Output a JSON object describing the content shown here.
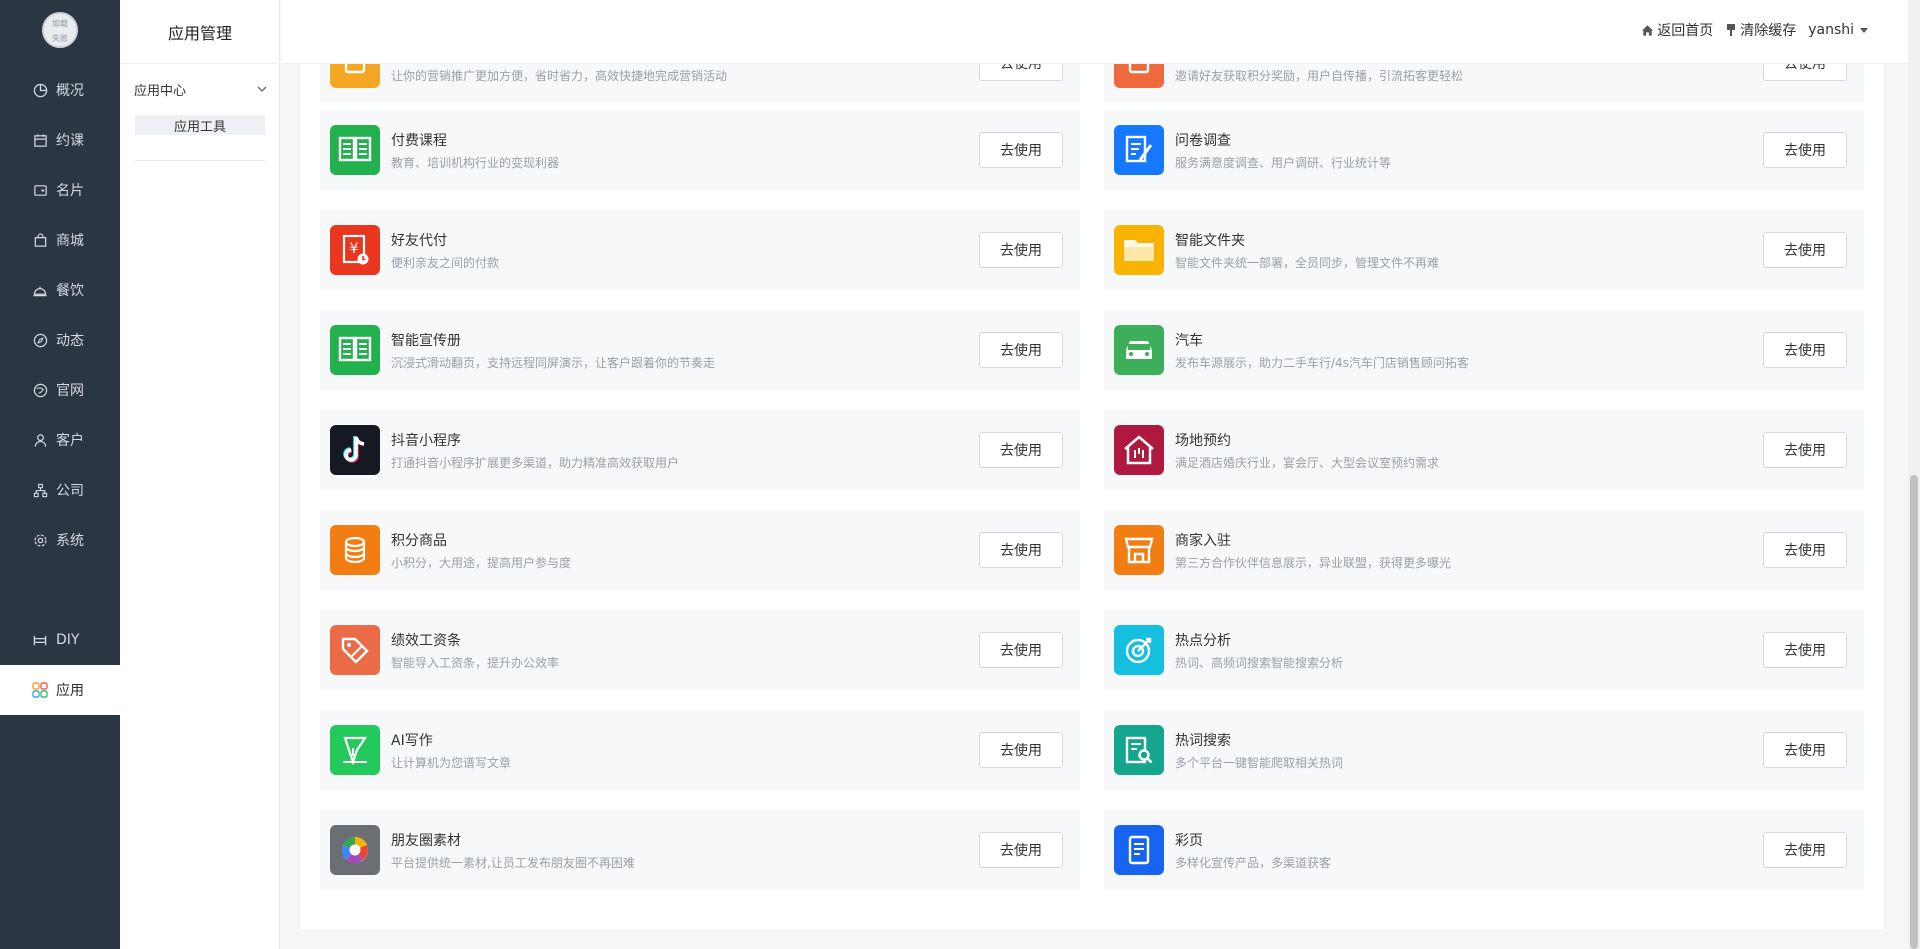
{
  "sidebar": {
    "logo_text": "加载\n失败",
    "items": [
      {
        "label": "概况",
        "icon": "pie-chart-icon"
      },
      {
        "label": "约课",
        "icon": "calendar-icon"
      },
      {
        "label": "名片",
        "icon": "card-icon"
      },
      {
        "label": "商城",
        "icon": "shopping-bag-icon"
      },
      {
        "label": "餐饮",
        "icon": "food-cover-icon"
      },
      {
        "label": "动态",
        "icon": "compass-icon"
      },
      {
        "label": "官网",
        "icon": "globe-icon"
      },
      {
        "label": "客户",
        "icon": "user-icon"
      },
      {
        "label": "公司",
        "icon": "org-chart-icon"
      },
      {
        "label": "系统",
        "icon": "gear-icon"
      },
      {
        "label": "DIY",
        "icon": "diy-icon"
      },
      {
        "label": "应用",
        "icon": "apps-grid-icon",
        "active": true
      }
    ]
  },
  "submenu": {
    "title": "应用管理",
    "group_label": "应用中心",
    "sub_label": "应用工具"
  },
  "header": {
    "back_home": "返回首页",
    "clear_cache": "清除缓存",
    "username": "yanshi"
  },
  "button_label": "去使用",
  "apps": [
    {
      "title": "",
      "desc": "让你的营销推广更加方便，省时省力，高效快捷地完成营销活动",
      "color": "#f5a623",
      "icon": "partial-icon"
    },
    {
      "title": "",
      "desc": "邀请好友获取积分奖励，用户自传播，引流拓客更轻松",
      "color": "#ee6a3d",
      "icon": "partial-icon"
    },
    {
      "title": "付费课程",
      "desc": "教育、培训机构行业的变现利器",
      "color": "#22b14c",
      "icon": "book-icon"
    },
    {
      "title": "问卷调查",
      "desc": "服务满意度调查、用户调研、行业统计等",
      "color": "#1677ff",
      "icon": "survey-icon"
    },
    {
      "title": "好友代付",
      "desc": "便利亲友之间的付款",
      "color": "#e8361f",
      "icon": "pay-icon"
    },
    {
      "title": "智能文件夹",
      "desc": "智能文件夹统一部署，全员同步，管理文件不再难",
      "color": "#f8b400",
      "icon": "folder-icon"
    },
    {
      "title": "智能宣传册",
      "desc": "沉浸式滑动翻页，支持远程同屏演示，让客户跟着你的节奏走",
      "color": "#22b14c",
      "icon": "book-icon"
    },
    {
      "title": "汽车",
      "desc": "发布车源展示，助力二手车行/4s汽车门店销售顾问拓客",
      "color": "#3dae5a",
      "icon": "car-icon"
    },
    {
      "title": "抖音小程序",
      "desc": "打通抖音小程序扩展更多渠道，助力精准高效获取用户",
      "color": "#161823",
      "icon": "tiktok-icon"
    },
    {
      "title": "场地预约",
      "desc": "满足酒店婚庆行业，宴会厅、大型会议室预约需求",
      "color": "#b0193f",
      "icon": "venue-icon"
    },
    {
      "title": "积分商品",
      "desc": "小积分，大用途，提高用户参与度",
      "color": "#f27e13",
      "icon": "coins-icon"
    },
    {
      "title": "商家入驻",
      "desc": "第三方合作伙伴信息展示，异业联盟，获得更多曝光",
      "color": "#f27e13",
      "icon": "store-icon"
    },
    {
      "title": "绩效工资条",
      "desc": "智能导入工资条，提升办公效率",
      "color": "#ea6b45",
      "icon": "salary-icon"
    },
    {
      "title": "热点分析",
      "desc": "热词、高频词搜索智能搜索分析",
      "color": "#15bfe0",
      "icon": "target-icon"
    },
    {
      "title": "AI写作",
      "desc": "让计算机为您谱写文章",
      "color": "#23c95a",
      "icon": "pen-icon"
    },
    {
      "title": "热词搜索",
      "desc": "多个平台一键智能爬取相关热词",
      "color": "#13a68d",
      "icon": "search-doc-icon"
    },
    {
      "title": "朋友圈素材",
      "desc": "平台提供统一素材,让员工发布朋友圈不再困难",
      "color": "#6b6e73",
      "icon": "aperture-icon"
    },
    {
      "title": "彩页",
      "desc": "多样化宣传产品，多渠道获客",
      "color": "#1764f0",
      "icon": "page-icon"
    }
  ]
}
